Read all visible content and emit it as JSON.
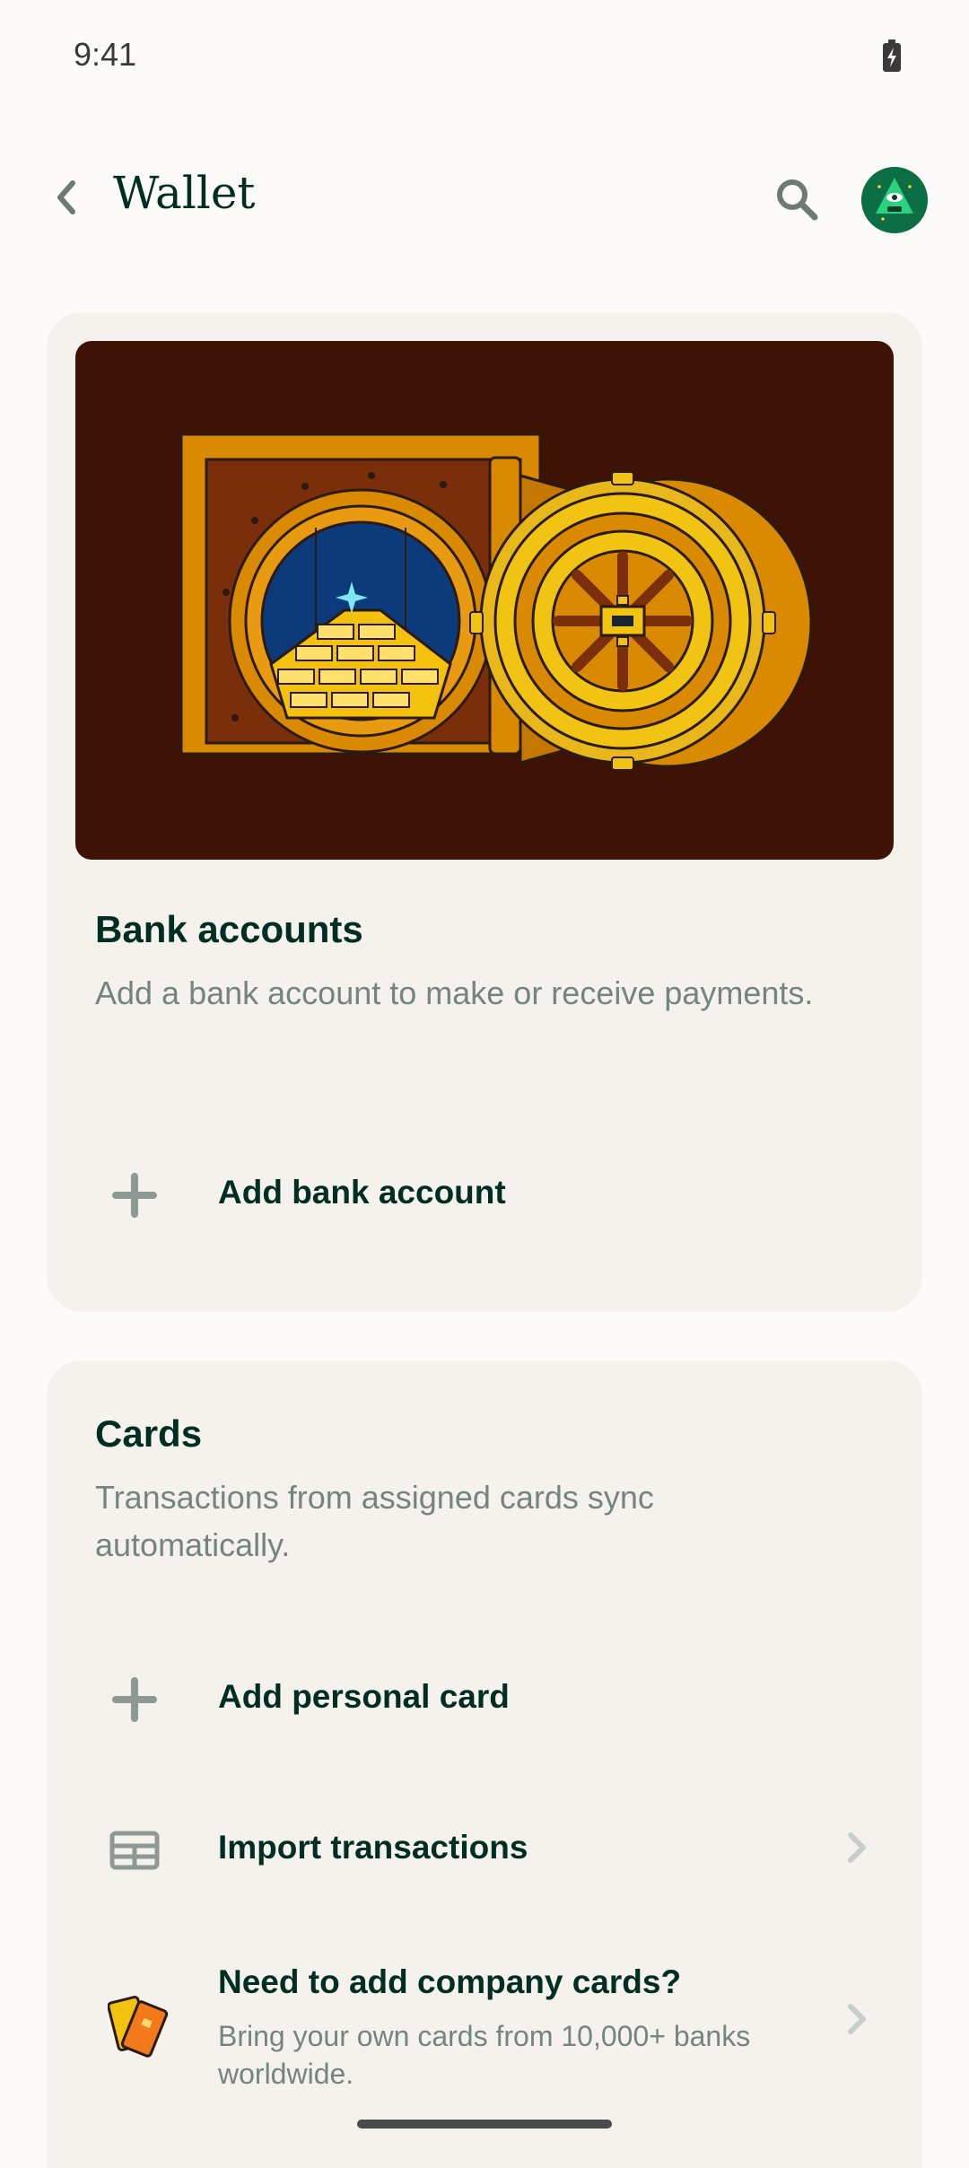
{
  "status_bar": {
    "time": "9:41"
  },
  "header": {
    "title": "Wallet"
  },
  "bank_section": {
    "title": "Bank accounts",
    "description": "Add a bank account to make or receive payments.",
    "add_label": "Add bank account"
  },
  "cards_section": {
    "title": "Cards",
    "description": "Transactions from assigned cards sync automatically.",
    "add_personal_label": "Add personal card",
    "import_label": "Import transactions",
    "company_title": "Need to add company cards?",
    "company_subtitle": "Bring your own cards from 10,000+ banks worldwide."
  },
  "icons": {
    "back": "back-arrow-icon",
    "search": "search-icon",
    "plus": "plus-icon",
    "table": "table-icon",
    "chevron": "chevron-right-icon",
    "cards": "credit-cards-icon",
    "battery": "battery-charging-icon"
  },
  "colors": {
    "primary_text": "#002E22",
    "secondary_text": "#76847E",
    "card_bg": "#F5F2EE",
    "hero_bg": "#3E1305",
    "accent_green": "#0B7A4B"
  }
}
